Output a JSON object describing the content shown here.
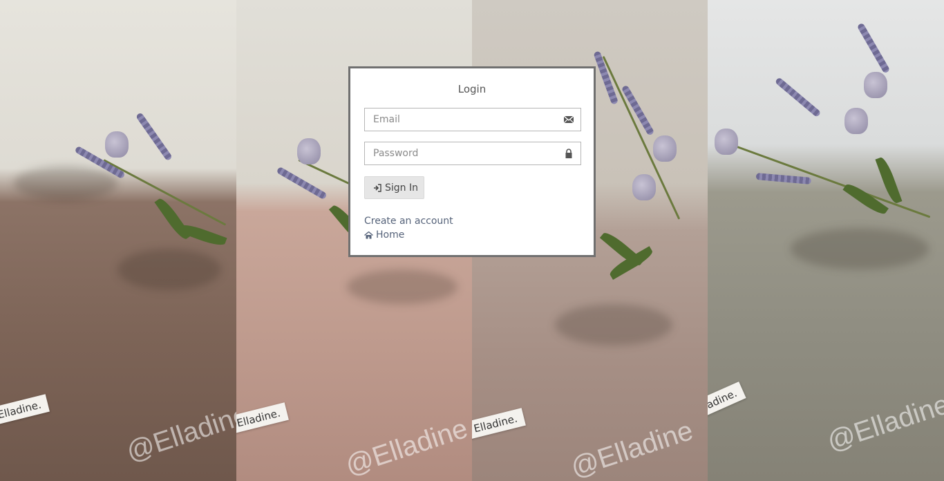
{
  "background": {
    "tag_text": "Elladine.",
    "watermark_text": "@Elladine"
  },
  "login": {
    "title": "Login",
    "email_placeholder": "Email",
    "email_icon": "envelope-icon",
    "password_placeholder": "Password",
    "password_icon": "lock-icon",
    "signin_label": "Sign In",
    "signin_icon": "sign-in-icon",
    "create_account_label": "Create an account",
    "home_label": "Home",
    "home_icon": "home-icon"
  },
  "colors": {
    "box_border": "#707070",
    "link": "#56637a",
    "button_bg": "#e6e6e6"
  }
}
